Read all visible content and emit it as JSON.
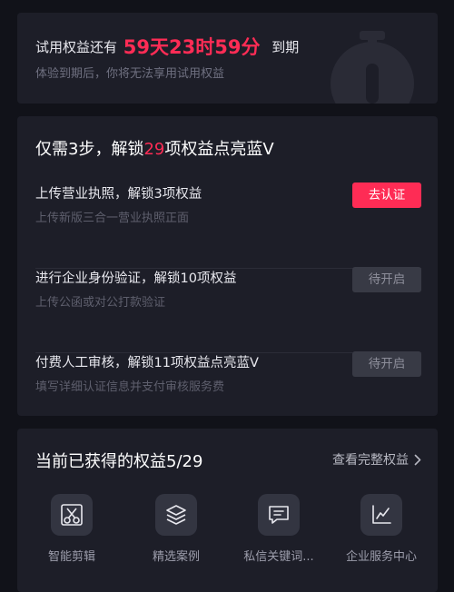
{
  "trial": {
    "prefix": "试用权益还有",
    "countdown": "59天23时59分",
    "suffix": "到期",
    "subtitle": "体验到期后，你将无法享用试用权益",
    "icon": "stopwatch-icon"
  },
  "steps": {
    "title_prefix": "仅需3步，解锁",
    "title_count": "29",
    "title_suffix": "项权益点亮蓝V",
    "items": [
      {
        "title": "上传营业执照，解锁3项权益",
        "subtitle": "上传新版三合一营业执照正面",
        "button": "去认证",
        "state": "active"
      },
      {
        "title": "进行企业身份验证，解锁10项权益",
        "subtitle": "上传公函或对公打款验证",
        "button": "待开启",
        "state": "disabled"
      },
      {
        "title": "付费人工审核，解锁11项权益点亮蓝V",
        "subtitle": "填写详细认证信息并支付审核服务费",
        "button": "待开启",
        "state": "disabled"
      }
    ]
  },
  "benefits": {
    "title": "当前已获得的权益5/29",
    "view_all": "查看完整权益",
    "items": [
      {
        "label": "智能剪辑",
        "icon": "scissors-icon"
      },
      {
        "label": "精选案例",
        "icon": "layers-icon"
      },
      {
        "label": "私信关键词...",
        "icon": "message-icon"
      },
      {
        "label": "企业服务中心",
        "icon": "chart-icon"
      }
    ]
  },
  "colors": {
    "background": "#111219",
    "card": "#1d1e28",
    "accent": "#fe2c55",
    "disabled_button": "#383a45",
    "icon_tile": "#333541"
  }
}
